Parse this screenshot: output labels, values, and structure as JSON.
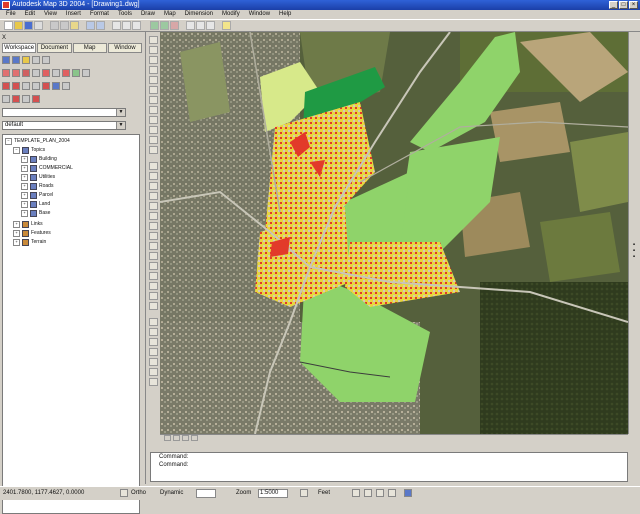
{
  "window": {
    "title": "Autodesk Map 3D 2004 - [Drawing1.dwg]",
    "controls": [
      "_",
      "□",
      "×"
    ]
  },
  "menu": [
    "File",
    "Edit",
    "View",
    "Insert",
    "Format",
    "Tools",
    "Draw",
    "Map",
    "Dimension",
    "Modify",
    "Window",
    "Help"
  ],
  "workspace": {
    "header": "X",
    "tabs": [
      "Workspace",
      "Document",
      "Map",
      "Window"
    ],
    "active_tab": 0,
    "combo_one": "",
    "combo_two": "default"
  },
  "tree": {
    "root": "TEMPLATE_PLAN_2004",
    "topics": "Topics",
    "children": [
      "Building",
      "COMMERCIAL",
      "Utilities",
      "Roads",
      "Parcel",
      "Land",
      "Base"
    ],
    "sections": [
      "Links",
      "Features",
      "Terrain"
    ]
  },
  "command": {
    "line1": "Command:",
    "line2": "Command:"
  },
  "status": {
    "coords": "2401.7800, 1177.4627, 0.0000",
    "snap": "Ortho",
    "dynamic_label": "Dynamic",
    "dynamic_value": "",
    "scale_label": "Zoom",
    "scale_value": "1:5000",
    "unit_label": "Feet"
  }
}
